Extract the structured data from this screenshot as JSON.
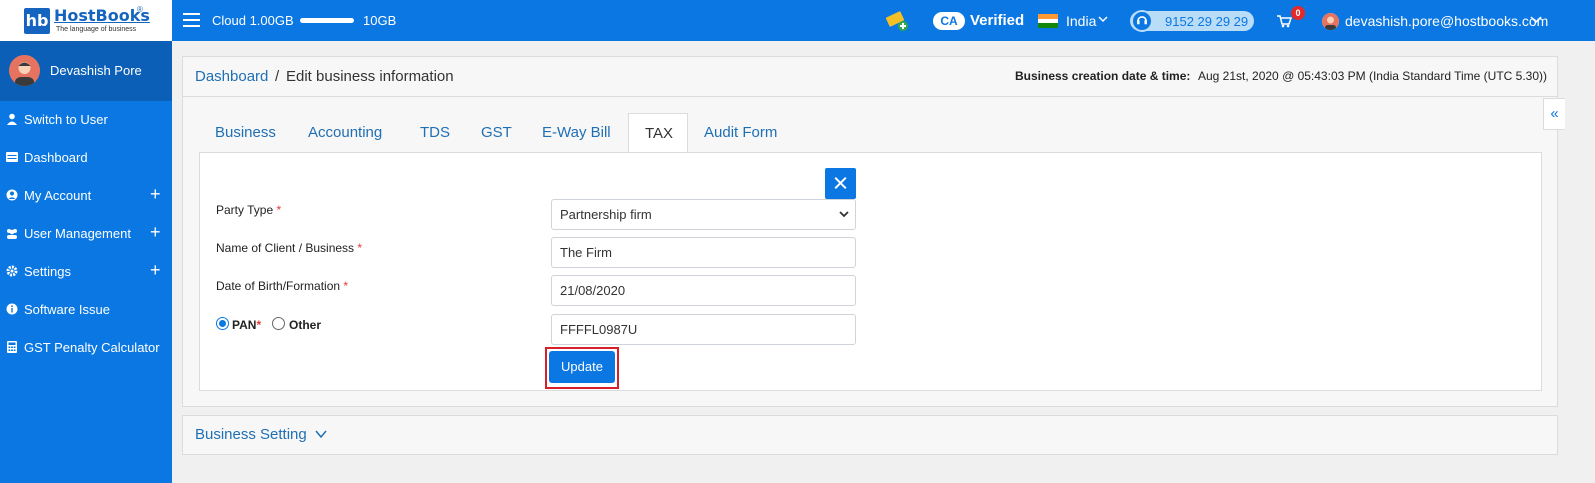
{
  "brand": {
    "mark": "hb",
    "name": "HostBooks",
    "registered": "®",
    "tagline": "The language of business"
  },
  "topbar": {
    "cloud_label": "Cloud 1.00GB",
    "cloud_max": "10GB",
    "ca_badge": "CA",
    "verified": "Verified",
    "country": "India",
    "phone": "9152 29 29 29",
    "cart_count": "0",
    "user_email": "devashish.pore@hostbooks.com"
  },
  "sidebar": {
    "profile_name": "Devashish Pore",
    "items": [
      {
        "label": "Switch to User",
        "icon": "user-icon",
        "expandable": false
      },
      {
        "label": "Dashboard",
        "icon": "dashboard-icon",
        "expandable": false
      },
      {
        "label": "My Account",
        "icon": "account-icon",
        "expandable": true
      },
      {
        "label": "User Management",
        "icon": "users-icon",
        "expandable": true
      },
      {
        "label": "Settings",
        "icon": "gear-icon",
        "expandable": true
      },
      {
        "label": "Software Issue",
        "icon": "info-icon",
        "expandable": false
      },
      {
        "label": "GST Penalty Calculator",
        "icon": "calculator-icon",
        "expandable": false
      }
    ],
    "plus": "+"
  },
  "breadcrumb": {
    "link": "Dashboard",
    "separator": "/",
    "current": "Edit business information"
  },
  "creation": {
    "label": "Business creation date & time:",
    "value": "Aug 21st, 2020 @ 05:43:03 PM (India Standard Time (UTC 5.30))"
  },
  "tabs": [
    {
      "label": "Business",
      "active": false
    },
    {
      "label": "Accounting",
      "active": false
    },
    {
      "label": "TDS",
      "active": false
    },
    {
      "label": "GST",
      "active": false
    },
    {
      "label": "E-Way Bill",
      "active": false
    },
    {
      "label": "TAX",
      "active": true
    },
    {
      "label": "Audit Form",
      "active": false
    }
  ],
  "form": {
    "party_type": {
      "label": "Party Type",
      "required": "*",
      "value": "Partnership firm"
    },
    "client_name": {
      "label": "Name of Client / Business",
      "required": "*",
      "value": "The Firm"
    },
    "dob": {
      "label": "Date of Birth/Formation",
      "required": "*",
      "value": "21/08/2020"
    },
    "id_type": {
      "pan_label": "PAN",
      "pan_required": "*",
      "other_label": "Other",
      "selected": "PAN"
    },
    "id_value": "FFFFL0987U",
    "update_label": "Update"
  },
  "collapse_label": "«",
  "business_setting": {
    "title": "Business Setting"
  },
  "colors": {
    "primary": "#0a77e3",
    "sidebar_profile": "#0b5fb6",
    "link": "#1f6fb5",
    "highlight": "#d6202b"
  }
}
